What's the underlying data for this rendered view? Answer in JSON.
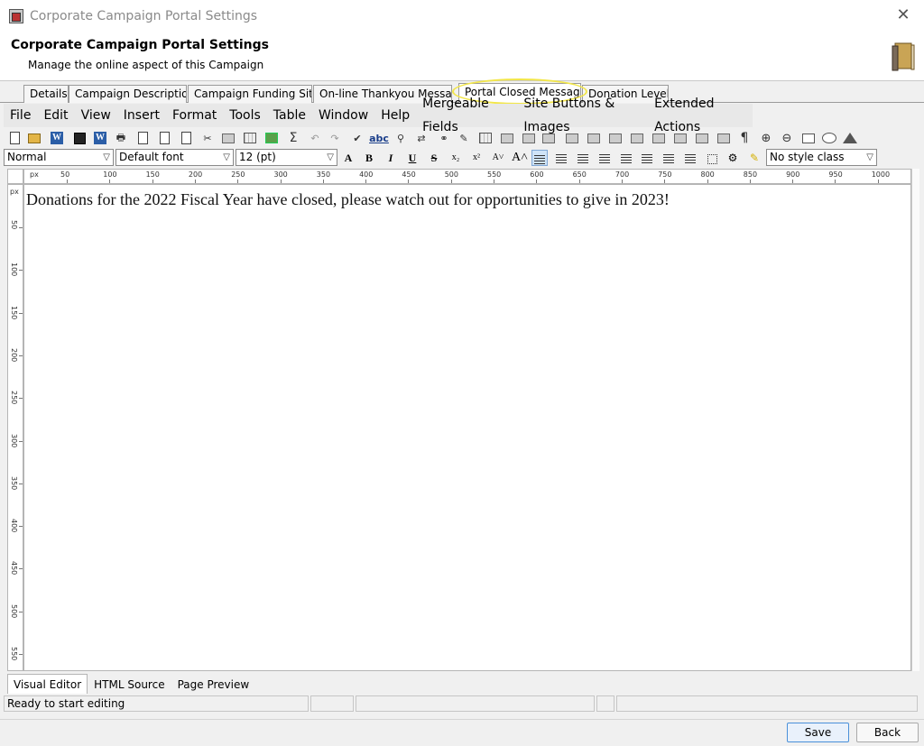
{
  "window": {
    "title": "Corporate Campaign Portal Settings"
  },
  "header": {
    "title": "Corporate Campaign Portal Settings",
    "subtitle": "Manage the online aspect of this Campaign"
  },
  "tabs": [
    {
      "label": "Details"
    },
    {
      "label": "Campaign Description"
    },
    {
      "label": "Campaign Funding Site"
    },
    {
      "label": "On-line Thankyou Message"
    },
    {
      "label": "Portal Closed Message"
    },
    {
      "label": "Donation Levels"
    }
  ],
  "active_tab": "Portal Closed Message",
  "menu": [
    "File",
    "Edit",
    "View",
    "Insert",
    "Format",
    "Tools",
    "Table",
    "Window",
    "Help",
    "Mergeable Fields",
    "Site Buttons & Images",
    "Extended Actions"
  ],
  "format_bar": {
    "paragraph_style": "Normal",
    "font": "Default font",
    "size": "12 (pt)",
    "style_class": "No style class",
    "btn_a": "A",
    "btn_bold": "B",
    "btn_italic": "I",
    "btn_underline": "U",
    "btn_strike": "S",
    "btn_sub": "x₂",
    "btn_sup": "x²"
  },
  "ruler": {
    "unit": "px",
    "h_labels": [
      "50",
      "100",
      "150",
      "200",
      "250",
      "300",
      "350",
      "400",
      "450",
      "500",
      "550",
      "600",
      "650",
      "700",
      "750",
      "800",
      "850",
      "900",
      "950",
      "1000"
    ],
    "v_labels": [
      "50",
      "100",
      "150",
      "200",
      "250",
      "300",
      "350",
      "400",
      "450",
      "500",
      "550"
    ]
  },
  "document": {
    "text": "Donations for the 2022 Fiscal Year have closed, please watch out for opportunities to give in 2023!"
  },
  "view_tabs": [
    {
      "label": "Visual Editor"
    },
    {
      "label": "HTML Source"
    },
    {
      "label": "Page Preview"
    }
  ],
  "status": {
    "message": "Ready to start editing"
  },
  "buttons": {
    "save": "Save",
    "back": "Back"
  },
  "colors": {
    "highlight": "#f2e64a",
    "primary_button_border": "#4a90d9"
  }
}
